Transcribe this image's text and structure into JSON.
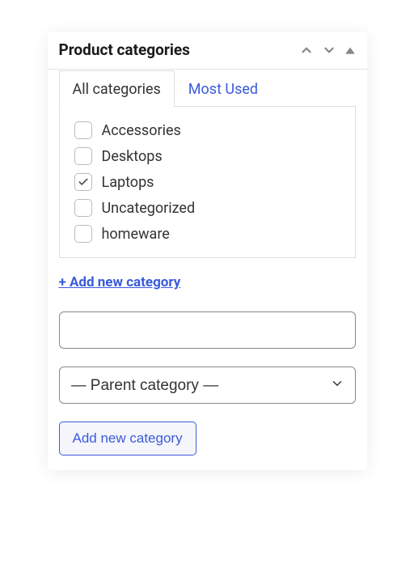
{
  "panel": {
    "title": "Product categories"
  },
  "tabs": {
    "all": "All categories",
    "most_used": "Most Used"
  },
  "categories": [
    {
      "label": "Accessories",
      "checked": false
    },
    {
      "label": "Desktops",
      "checked": false
    },
    {
      "label": "Laptops",
      "checked": true
    },
    {
      "label": "Uncategorized",
      "checked": false
    },
    {
      "label": "homeware",
      "checked": false
    }
  ],
  "add_link": "+ Add new category",
  "new_category_input": "",
  "parent_select": {
    "selected": "— Parent category —"
  },
  "add_button": "Add new category"
}
